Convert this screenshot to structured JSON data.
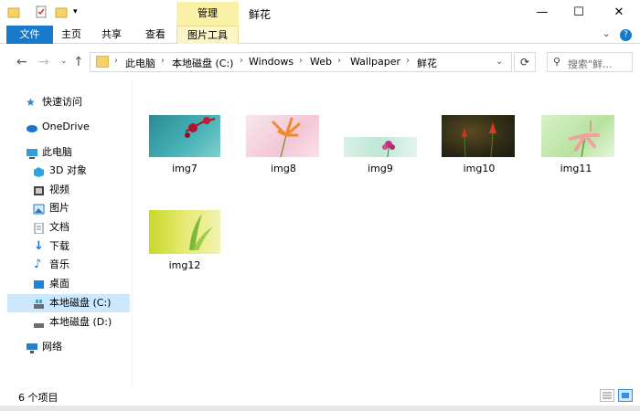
{
  "window": {
    "title": "鲜花",
    "context_tab_header": "管理"
  },
  "ribbon": {
    "tabs": [
      "文件",
      "主页",
      "共享",
      "查看",
      "图片工具"
    ]
  },
  "address": {
    "crumbs": [
      "此电脑",
      "本地磁盘 (C:)",
      "Windows",
      "Web",
      "Wallpaper",
      "鲜花"
    ]
  },
  "search": {
    "placeholder": "搜索\"鲜..."
  },
  "nav": {
    "items": [
      {
        "label": "快速访问",
        "icon": "star-icon",
        "color": "#1e88e5"
      },
      {
        "label": "OneDrive",
        "icon": "cloud-icon",
        "color": "#1976d2"
      },
      {
        "label": "此电脑",
        "icon": "computer-icon",
        "color": "#3a9ad9"
      },
      {
        "label": "3D 对象",
        "icon": "cube-icon",
        "color": "#29a8e0"
      },
      {
        "label": "视频",
        "icon": "video-icon",
        "color": "#444444"
      },
      {
        "label": "图片",
        "icon": "picture-icon",
        "color": "#2b79c2"
      },
      {
        "label": "文档",
        "icon": "document-icon",
        "color": "#6b7c93"
      },
      {
        "label": "下载",
        "icon": "download-icon",
        "color": "#1e73c8"
      },
      {
        "label": "音乐",
        "icon": "music-icon",
        "color": "#1e73c8"
      },
      {
        "label": "桌面",
        "icon": "desktop-icon",
        "color": "#1c86d4"
      },
      {
        "label": "本地磁盘 (C:)",
        "icon": "drive-c-icon",
        "color": "#6d6d6d"
      },
      {
        "label": "本地磁盘 (D:)",
        "icon": "drive-d-icon",
        "color": "#6d6d6d"
      },
      {
        "label": "网络",
        "icon": "network-icon",
        "color": "#2e7dc9"
      }
    ],
    "selected_index": 10
  },
  "files": [
    {
      "name": "img7"
    },
    {
      "name": "img8"
    },
    {
      "name": "img9"
    },
    {
      "name": "img10"
    },
    {
      "name": "img11"
    },
    {
      "name": "img12"
    }
  ],
  "status": {
    "count": "6 个项目"
  },
  "colors": {
    "file_tab": "#1979ca",
    "context_tab": "#f9f1a5",
    "selection": "#cce8ff"
  }
}
